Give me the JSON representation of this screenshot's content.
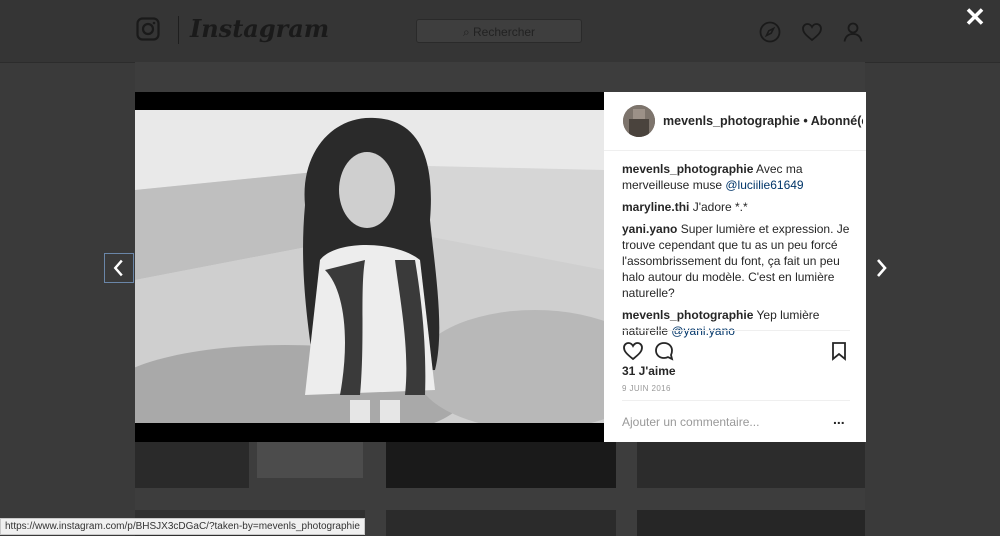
{
  "header": {
    "logo_text": "Instagram",
    "search_placeholder": "Rechercher"
  },
  "modal": {
    "close_label": "✕",
    "post": {
      "username": "mevenls_photographie",
      "follow_status": "• Abonné(e)",
      "comments": [
        {
          "user": "mevenls_photographie",
          "text": " Avec ma merveilleuse muse ",
          "mention": "@luciilie61649"
        },
        {
          "user": "maryline.thi",
          "text": " J'adore *.*",
          "mention": ""
        },
        {
          "user": "yani.yano",
          "text": " Super lumière et expression. Je trouve cependant que tu as un peu forcé l'assombrissement du font, ça fait un peu halo autour du modèle. C'est en lumière naturelle?",
          "mention": ""
        },
        {
          "user": "mevenls_photographie",
          "text": " Yep lumière naturelle ",
          "mention": "@yani.yano"
        }
      ],
      "likes": "31 J'aime",
      "date": "9 JUIN 2016",
      "add_comment_placeholder": "Ajouter un commentaire...",
      "more_options": "..."
    }
  },
  "status_bar": {
    "url": "https://www.instagram.com/p/BHSJX3cDGaC/?taken-by=mevenls_photographie"
  }
}
